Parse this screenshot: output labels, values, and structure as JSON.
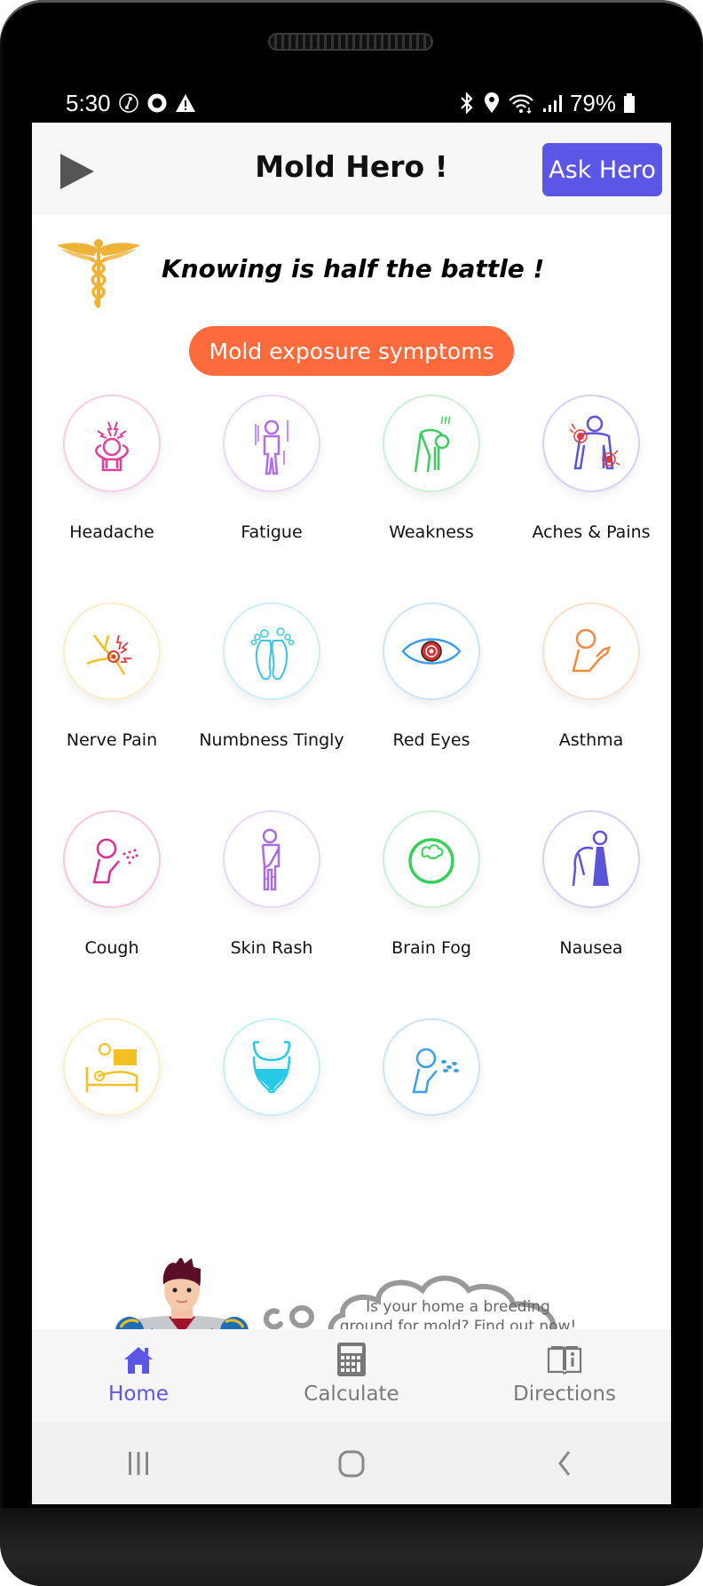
{
  "status_bar": {
    "time": "5:30",
    "left_icons": [
      "sync-circle-icon",
      "record-circle-icon",
      "warning-icon"
    ],
    "right_icons": [
      "bluetooth-icon",
      "location-icon",
      "wifi-icon",
      "signal-icon"
    ],
    "battery_percent": "79%"
  },
  "header": {
    "title": "Mold Hero !",
    "play_icon": "play-icon",
    "ask_button": "Ask Hero"
  },
  "intro": {
    "logo_icon": "caduceus-icon",
    "tagline": "Knowing is half the battle !",
    "section_button": "Mold exposure symptoms"
  },
  "symptoms": [
    {
      "label": "Headache",
      "icon": "headache-icon",
      "color": "#e0409a"
    },
    {
      "label": "Fatigue",
      "icon": "fatigue-icon",
      "color": "#b06ee8"
    },
    {
      "label": "Weakness",
      "icon": "weakness-icon",
      "color": "#3ccb63"
    },
    {
      "label": "Aches & Pains",
      "icon": "aches-pains-icon",
      "color": "#5a54d8"
    },
    {
      "label": "Nerve Pain",
      "icon": "nerve-pain-icon",
      "color": "#f2c022"
    },
    {
      "label": "Numbness Tingly",
      "icon": "numbness-icon",
      "color": "#3cc4e0"
    },
    {
      "label": "Red Eyes",
      "icon": "red-eyes-icon",
      "color": "#3a9ee8"
    },
    {
      "label": "Asthma",
      "icon": "asthma-icon",
      "color": "#f08a40"
    },
    {
      "label": "Cough",
      "icon": "cough-icon",
      "color": "#d92f92"
    },
    {
      "label": "Skin Rash",
      "icon": "skin-rash-icon",
      "color": "#a86ee0"
    },
    {
      "label": "Brain Fog",
      "icon": "brain-fog-icon",
      "color": "#38d058"
    },
    {
      "label": "Nausea",
      "icon": "nausea-icon",
      "color": "#5a54d8"
    },
    {
      "label": "",
      "icon": "insomnia-bed-icon",
      "color": "#f2c022"
    },
    {
      "label": "",
      "icon": "bladder-icon",
      "color": "#28c8e8"
    },
    {
      "label": "",
      "icon": "sneeze-icon",
      "color": "#3a9ee8"
    }
  ],
  "promo": {
    "hero_image": "superhero-illustration",
    "bubble_line1": "Is your home a breeding",
    "bubble_line2": "ground for mold? Find out now!"
  },
  "bottom_nav": [
    {
      "label": "Home",
      "icon": "home-icon",
      "active": true
    },
    {
      "label": "Calculate",
      "icon": "calculator-icon",
      "active": false
    },
    {
      "label": "Directions",
      "icon": "book-info-icon",
      "active": false
    }
  ],
  "system_nav": [
    "recent-apps-icon",
    "home-circle-icon",
    "back-icon"
  ],
  "colors": {
    "accent": "#5b56e6",
    "pill": "#fd6a3c",
    "header_bg": "#f7f7f7",
    "nav_inactive": "#7a7a7a"
  }
}
